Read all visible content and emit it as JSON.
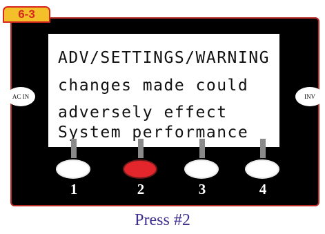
{
  "step_label": "6-3",
  "lcd": {
    "lines": [
      "ADV/SETTINGS/WARNING",
      "changes made could",
      "adversely effect",
      "System performance"
    ]
  },
  "indicators": {
    "left": "AC IN",
    "right": "INV"
  },
  "buttons": [
    {
      "label": "1",
      "active": false
    },
    {
      "label": "2",
      "active": true
    },
    {
      "label": "3",
      "active": false
    },
    {
      "label": "4",
      "active": false
    }
  ],
  "caption": "Press #2",
  "colors": {
    "panel": "#000000",
    "tab_fill": "#f3c02a",
    "tab_border": "#d6271f",
    "active_button": "#e3262c",
    "caption_text": "#3d2f8c"
  }
}
